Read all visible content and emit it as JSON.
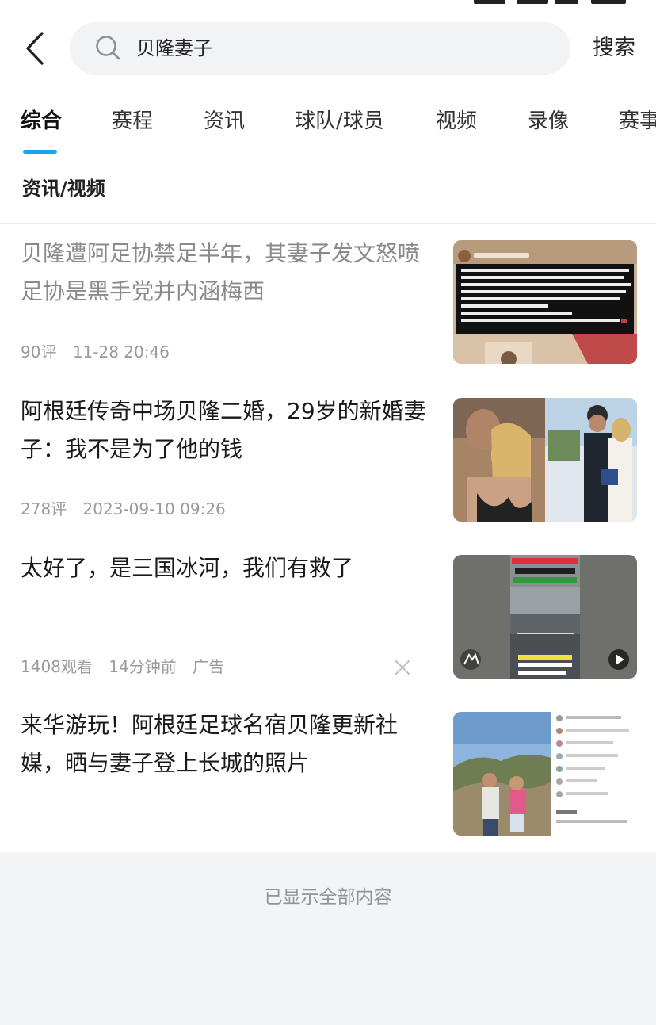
{
  "search": {
    "query": "贝隆妻子",
    "submit_label": "搜索"
  },
  "tabs": [
    {
      "label": "综合",
      "active": true
    },
    {
      "label": "赛程"
    },
    {
      "label": "资讯"
    },
    {
      "label": "球队/球员"
    },
    {
      "label": "视频"
    },
    {
      "label": "录像"
    },
    {
      "label": "赛事"
    }
  ],
  "section": {
    "label": "资讯/视频"
  },
  "news": [
    {
      "title": "贝隆遭阿足协禁足半年，其妻子发文怒喷足协是黑手党并内涵梅西",
      "comments": "90评",
      "time": "11-28 20:46",
      "read": true,
      "thumb_icon": "instagram-story-screenshot"
    },
    {
      "title": "阿根廷传奇中场贝隆二婚，29岁的新婚妻子：我不是为了他的钱",
      "comments": "278评",
      "time": "2023-09-10 09:26",
      "thumb_icon": "couple-photo-collage"
    },
    {
      "title": "太好了，是三国冰河，我们有救了",
      "views": "1408观看",
      "time": "14分钟前",
      "ad_label": "广告",
      "thumb_icon": "video-thumbnail"
    },
    {
      "title": "来华游玩！阿根廷足球名宿贝隆更新社媒，晒与妻子登上长城的照片",
      "thumb_icon": "great-wall-photo"
    }
  ],
  "footer": {
    "text": "已显示全部内容"
  },
  "colors": {
    "accent": "#1aa3f0",
    "read_title": "#8a8a8a",
    "meta": "#9a9a9a",
    "footer_bg": "#f3f4f6"
  }
}
